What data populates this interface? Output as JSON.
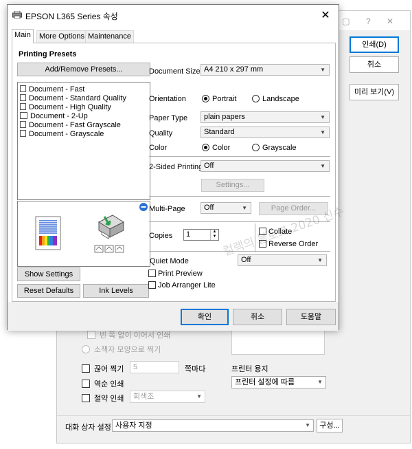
{
  "window": {
    "title": "EPSON L365 Series 속성"
  },
  "tabs": [
    "Main",
    "More Options",
    "Maintenance"
  ],
  "main": {
    "printing_presets_title": "Printing Presets",
    "add_remove_presets": "Add/Remove Presets...",
    "presets": [
      "Document - Fast",
      "Document - Standard Quality",
      "Document - High Quality",
      "Document - 2-Up",
      "Document - Fast Grayscale",
      "Document - Grayscale"
    ],
    "show_settings": "Show Settings",
    "reset_defaults": "Reset Defaults",
    "ink_levels": "Ink Levels",
    "document_size_label": "Document Size",
    "document_size_value": "A4 210 x 297 mm",
    "orientation_label": "Orientation",
    "orientation_portrait": "Portrait",
    "orientation_landscape": "Landscape",
    "paper_type_label": "Paper Type",
    "paper_type_value": "plain papers",
    "quality_label": "Quality",
    "quality_value": "Standard",
    "color_label": "Color",
    "color_color": "Color",
    "color_grayscale": "Grayscale",
    "two_sided_label": "2-Sided Printing",
    "two_sided_value": "Off",
    "settings_button": "Settings...",
    "multi_page_label": "Multi-Page",
    "multi_page_value": "Off",
    "page_order_button": "Page Order...",
    "copies_label": "Copies",
    "copies_value": "1",
    "collate_label": "Collate",
    "reverse_order_label": "Reverse Order",
    "quiet_mode_label": "Quiet Mode",
    "quiet_mode_value": "Off",
    "print_preview_label": "Print Preview",
    "job_arranger_label": "Job Arranger Lite"
  },
  "footer": {
    "ok": "확인",
    "cancel": "취소",
    "help": "도움말"
  },
  "background_dialog": {
    "title_icons": "▢ ? ✕",
    "print_button": "인쇄(D)",
    "cancel_button": "취소",
    "preview_button": "미리 보기(V)",
    "no_gap_print": "빈 쪽 없이 이어서 인쇄",
    "print_small": "소책자 모양으로 찍기",
    "cut_print": "끊어 찍기",
    "cut_value": "5",
    "per_page": "쪽마다",
    "printer_paper_label": "프린터 용지",
    "printer_paper_value": "프린터 설정에 따름",
    "reverse_print": "역순 인쇄",
    "save_print": "절약 인쇄",
    "save_value": "회색조",
    "dialog_settings_label": "대화 상자 설정",
    "dialog_settings_value": "사용자 지정",
    "configure_button": "구성..."
  },
  "watermark": "컬렉의 블로그 2020 신수"
}
